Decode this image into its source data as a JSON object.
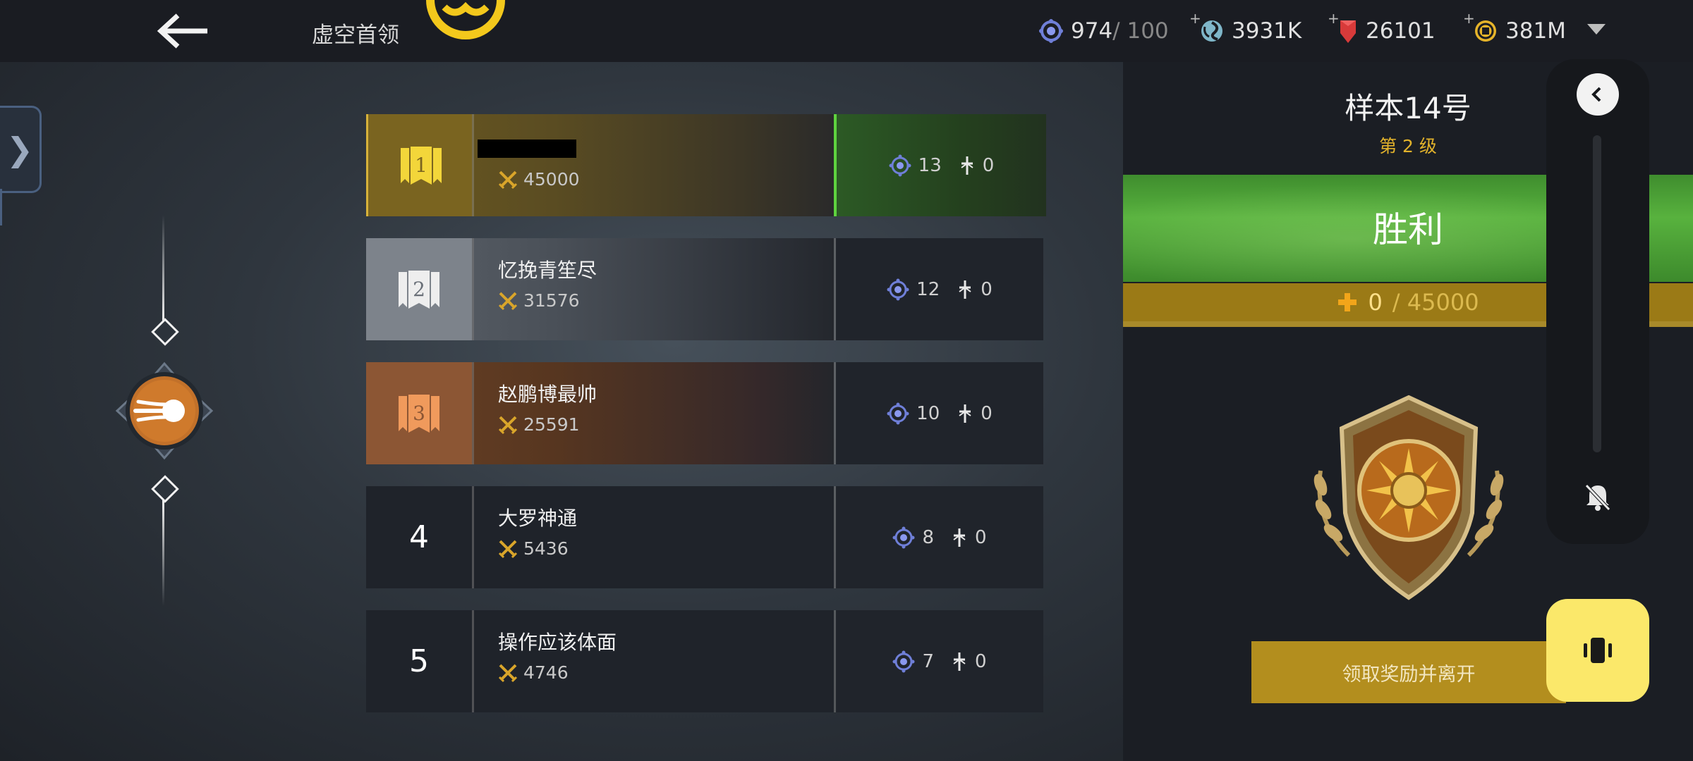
{
  "header": {
    "back_icon": "arrow-left-icon",
    "title": "虚空首领",
    "resources": [
      {
        "name": "energy",
        "icon": "energy-orb-icon",
        "value": "974",
        "max": " / 100",
        "color": "#6f7fd8"
      },
      {
        "name": "crystal",
        "icon": "swirl-gem-icon",
        "value": "3931K",
        "color": "#7fb6c9"
      },
      {
        "name": "ruby",
        "icon": "red-gem-icon",
        "value": "26101",
        "color": "#d83a3a"
      },
      {
        "name": "gold",
        "icon": "gold-coin-icon",
        "value": "381M",
        "color": "#e6b42a"
      }
    ]
  },
  "leaderboard": {
    "rows": [
      {
        "rank": "1",
        "name": "",
        "redacted": true,
        "score": "45000",
        "kills": "13",
        "deaths": "0"
      },
      {
        "rank": "2",
        "name": "忆挽青笙尽",
        "score": "31576",
        "kills": "12",
        "deaths": "0"
      },
      {
        "rank": "3",
        "name": "赵鹏博最帅",
        "score": "25591",
        "kills": "10",
        "deaths": "0"
      },
      {
        "rank": "4",
        "name": "大罗神通",
        "score": "5436",
        "kills": "8",
        "deaths": "0"
      },
      {
        "rank": "5",
        "name": "操作应该体面",
        "score": "4746",
        "kills": "7",
        "deaths": "0"
      }
    ]
  },
  "result": {
    "boss_name": "样本14号",
    "boss_level": "第 2 级",
    "outcome": "胜利",
    "reward_current": "0",
    "reward_total": "/ 45000",
    "claim_button": "领取奖励并离开"
  },
  "overlay": {
    "collapse_icon": "chevron-left-icon",
    "mute_icon": "mute-icon",
    "vibrate_icon": "vibrate-icon"
  },
  "colors": {
    "accent_gold": "#e1b22b",
    "victory_green": "#58b23e",
    "rank1": "#7a6420",
    "rank2": "#7d838b",
    "rank3": "#8c5634"
  }
}
